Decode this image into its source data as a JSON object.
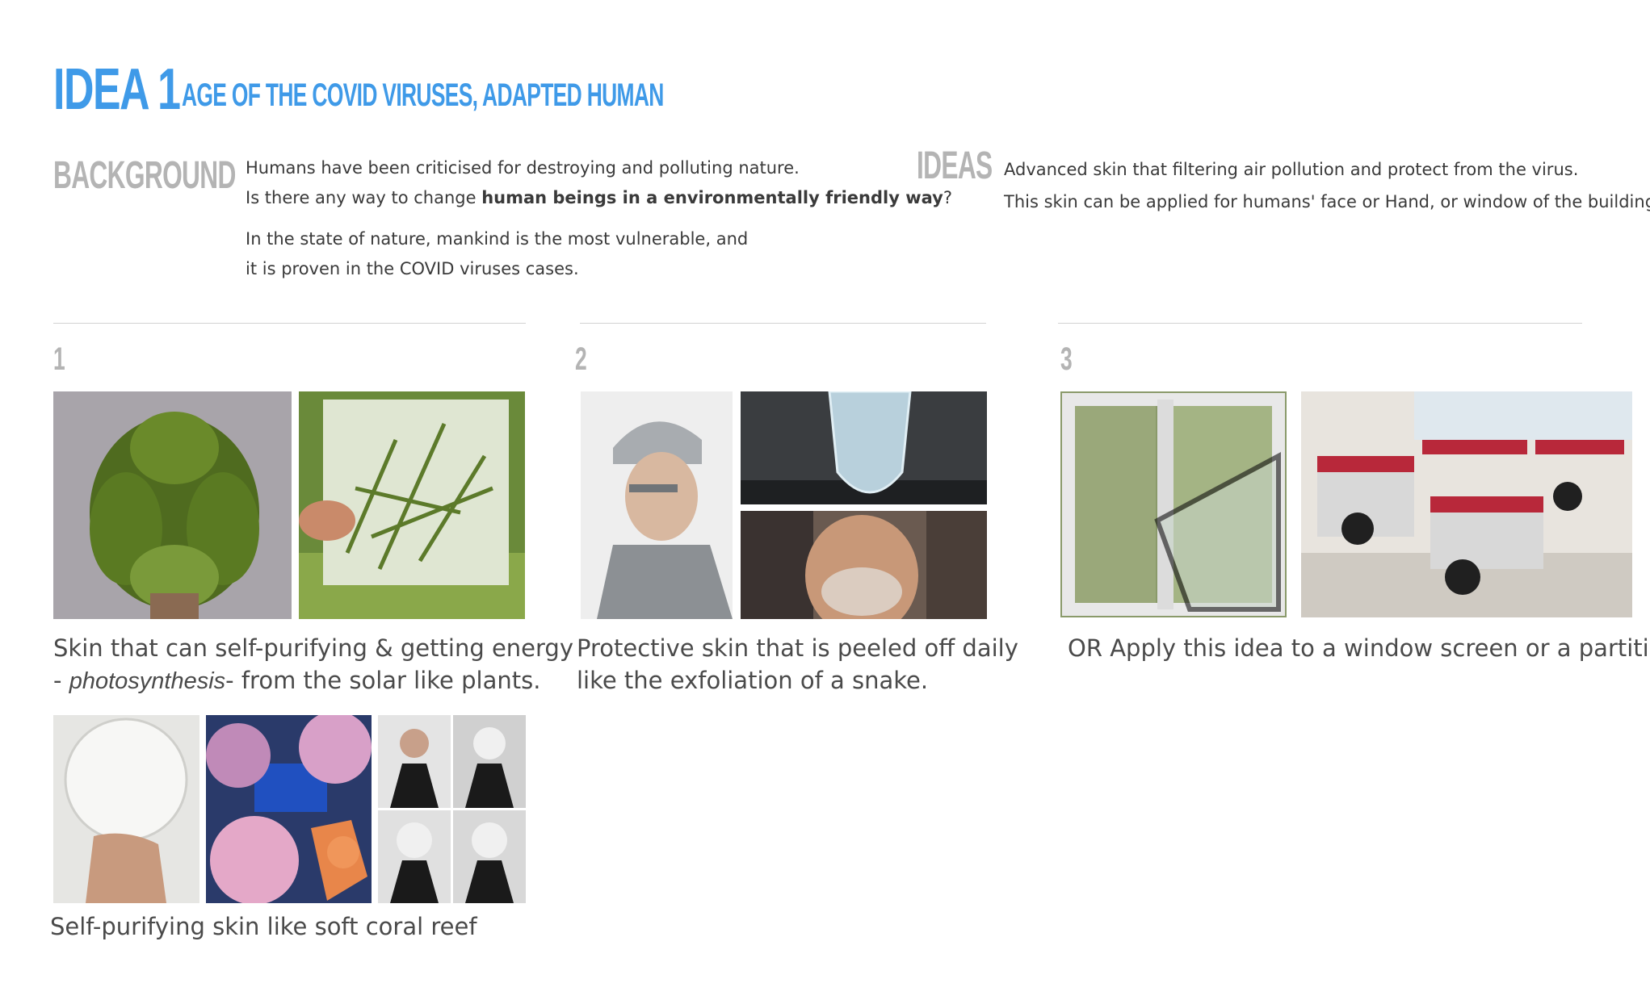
{
  "header": {
    "idea_label": "IDEA 1",
    "subtitle": "AGE OF THE COVID VIRUSES, ADAPTED HUMAN"
  },
  "background": {
    "heading": "BACKGROUND",
    "line1": "Humans have been criticised for destroying and polluting nature.",
    "line2_prefix": "Is there any way to change ",
    "line2_bold": "human beings in a environmentally friendly way",
    "line2_suffix": "?",
    "line3": "In the state of nature, mankind is the most vulnerable, and",
    "line4": "it is proven in the COVID viruses cases."
  },
  "ideas": {
    "heading": "IDEAS",
    "line1": "Advanced skin that filtering air pollution and protect from the virus.",
    "line2": "This skin can be applied for humans' face or Hand, or window of the building"
  },
  "columns": [
    {
      "number": "1",
      "caption_line1": "Skin that can self-purifying &  getting energy",
      "caption_line2_prefix": "- ",
      "caption_line2_italic": "photosynthesis",
      "caption_line2_suffix": "- from the solar like plants.",
      "caption2": "Self-purifying skin like soft coral reef"
    },
    {
      "number": "2",
      "caption_line1": "Protective skin that is peeled off daily",
      "caption_line2": "like the exfoliation of a snake."
    },
    {
      "number": "3",
      "caption_line1": "OR Apply this idea to a window screen or a partition"
    }
  ],
  "colors": {
    "accent": "#3f9ae8",
    "heading_gray": "#b4b4b4",
    "text": "#3a3a3a"
  }
}
